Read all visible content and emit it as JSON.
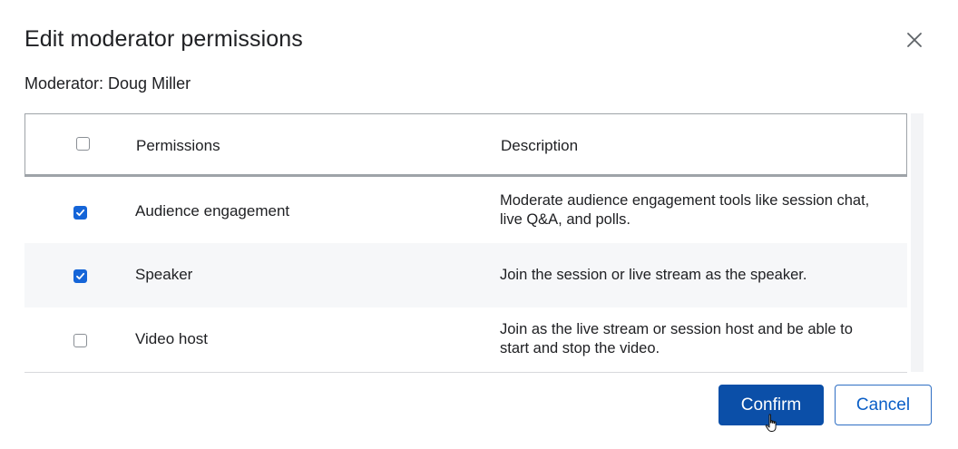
{
  "dialog": {
    "title": "Edit moderator permissions",
    "moderator_label": "Moderator: Doug Miller"
  },
  "table": {
    "headers": {
      "permissions": "Permissions",
      "description": "Description"
    },
    "select_all_checked": false,
    "rows": [
      {
        "name": "Audience engagement",
        "description": "Moderate audience engagement tools like session chat, live Q&A, and polls.",
        "checked": true
      },
      {
        "name": "Speaker",
        "description": "Join the session or live stream as the speaker.",
        "checked": true
      },
      {
        "name": "Video host",
        "description": "Join as the live stream or session host and be able to start and stop the video.",
        "checked": false
      }
    ]
  },
  "footer": {
    "confirm_label": "Confirm",
    "cancel_label": "Cancel"
  },
  "icons": {
    "close": "close-icon",
    "check": "check-icon",
    "cursor": "hand-pointer-icon"
  },
  "colors": {
    "primary": "#0b4fa8",
    "checkbox_checked": "#1565d8",
    "row_alt": "#f6f7f9"
  }
}
